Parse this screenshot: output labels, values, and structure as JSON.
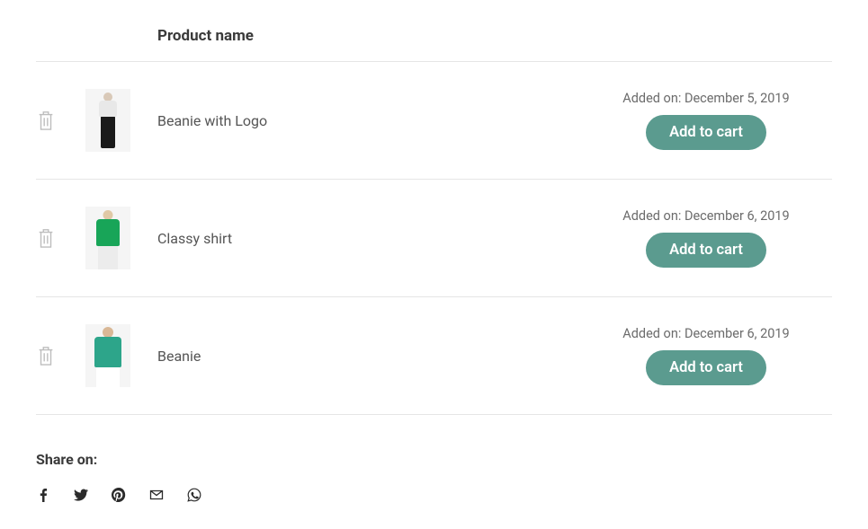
{
  "header": {
    "product_name": "Product name"
  },
  "added_on_prefix": "Added on: ",
  "add_to_cart_label": "Add to cart",
  "products": [
    {
      "name": "Beanie with Logo",
      "added_on": "December 5, 2019"
    },
    {
      "name": "Classy shirt",
      "added_on": "December 6, 2019"
    },
    {
      "name": "Beanie",
      "added_on": "December 6, 2019"
    }
  ],
  "share": {
    "label": "Share on:"
  }
}
